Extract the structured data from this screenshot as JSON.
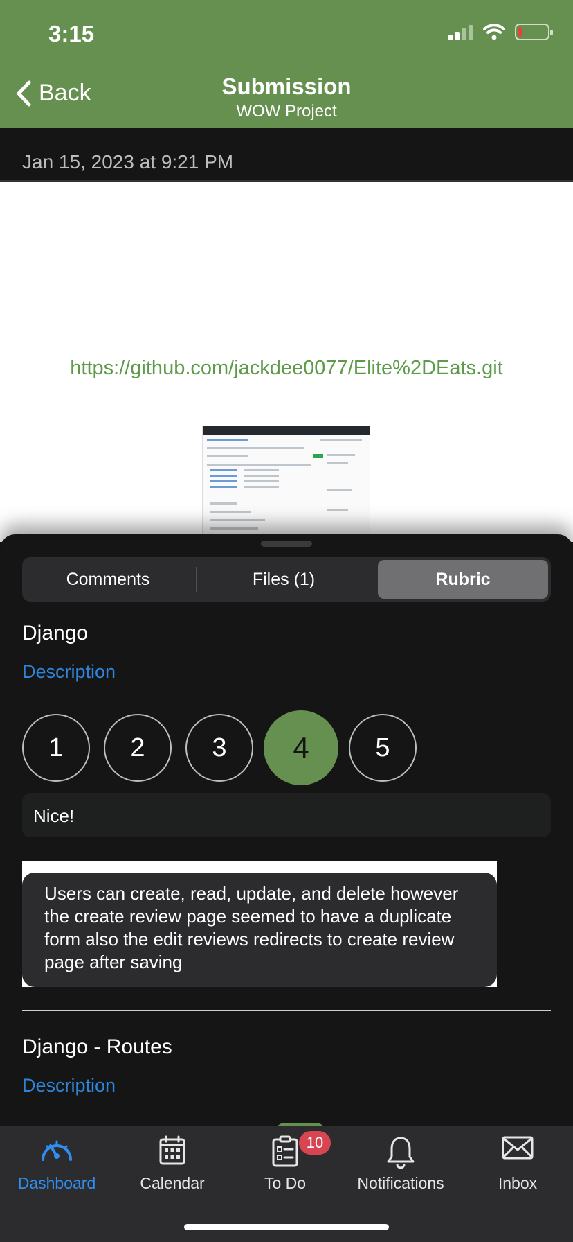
{
  "status_bar": {
    "time": "3:15"
  },
  "nav": {
    "back_label": "Back",
    "title": "Submission",
    "subtitle": "WOW Project"
  },
  "submission": {
    "date": "Jan 15, 2023 at 9:21 PM",
    "link": "https://github.com/jackdee0077/Elite%2DEats.git"
  },
  "tabs": {
    "comments": "Comments",
    "files": "Files (1)",
    "rubric": "Rubric",
    "selected": "Rubric"
  },
  "rubric": {
    "criteria": [
      {
        "title": "Django",
        "description_label": "Description",
        "ratings": [
          "1",
          "2",
          "3",
          "4",
          "5"
        ],
        "selected_rating": "4",
        "comment": "Nice!",
        "feedback": "Users can create, read, update, and delete however the create review page seemed to have a duplicate form also the edit reviews redirects to create review page after saving"
      },
      {
        "title": "Django - Routes",
        "description_label": "Description"
      }
    ]
  },
  "tab_bar": {
    "items": [
      {
        "label": "Dashboard",
        "icon": "dashboard-icon",
        "active": true
      },
      {
        "label": "Calendar",
        "icon": "calendar-icon"
      },
      {
        "label": "To Do",
        "icon": "todo-icon",
        "badge": "10"
      },
      {
        "label": "Notifications",
        "icon": "bell-icon"
      },
      {
        "label": "Inbox",
        "icon": "envelope-icon"
      }
    ]
  },
  "colors": {
    "brand_green": "#66904f",
    "link_green": "#5d9a4a",
    "link_blue": "#2e84d8",
    "active_tab_blue": "#2e8ff0",
    "badge_red": "#d64551"
  }
}
